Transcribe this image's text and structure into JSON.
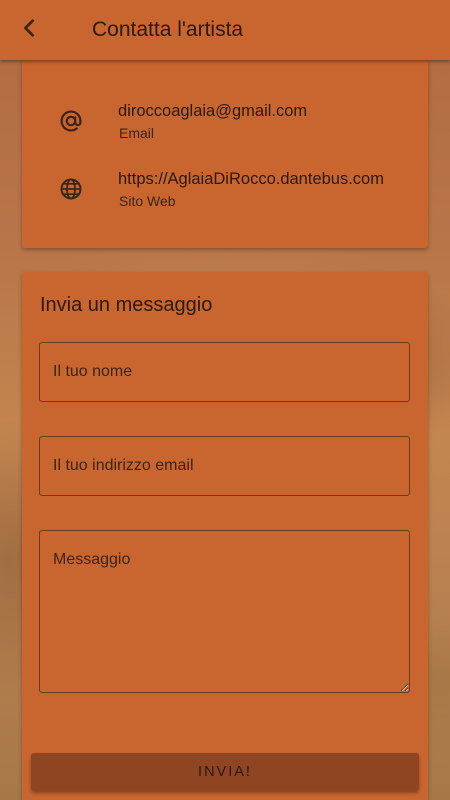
{
  "header": {
    "title": "Contatta l'artista",
    "back_icon": "chevron-left-icon"
  },
  "contact_info": {
    "items": [
      {
        "icon": "at-sign-icon",
        "value": "diroccoaglaia@gmail.com",
        "label": "Email"
      },
      {
        "icon": "globe-icon",
        "value": "https://AglaiaDiRocco.dantebus.com",
        "label": "Sito Web"
      }
    ]
  },
  "message_form": {
    "title": "Invia un messaggio",
    "name_placeholder": "Il tuo nome",
    "email_placeholder": "Il tuo indirizzo email",
    "message_placeholder": "Messaggio",
    "send_label": "INVIA!"
  },
  "colors": {
    "accent": "#c9652f",
    "button": "#8f4522",
    "text": "#2a1a12"
  }
}
